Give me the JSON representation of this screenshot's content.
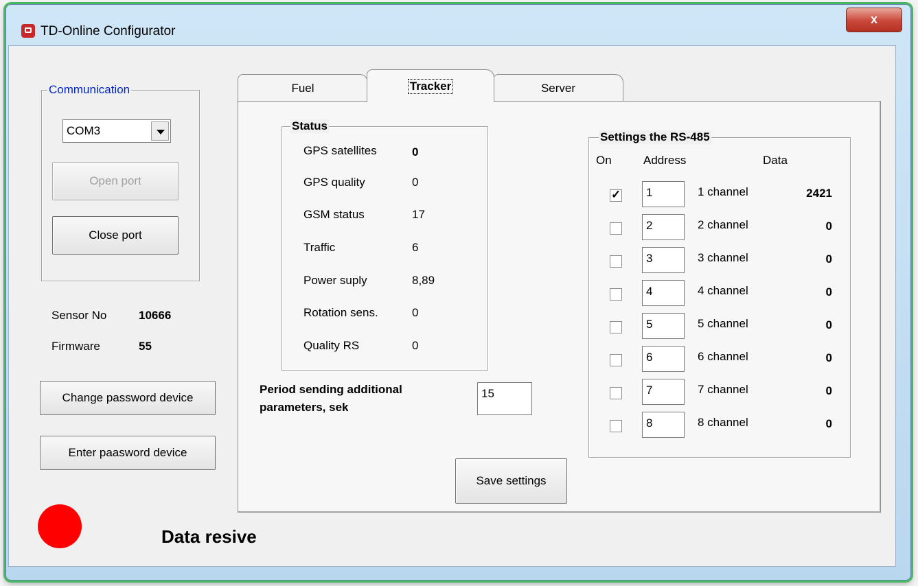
{
  "window": {
    "title": "TD-Online Configurator",
    "close_label": "x"
  },
  "communication": {
    "group_title": "Communication",
    "port": "COM3",
    "open_port_label": "Open port",
    "close_port_label": "Close port"
  },
  "device": {
    "sensor_label": "Sensor No",
    "sensor_value": "10666",
    "firmware_label": "Firmware",
    "firmware_value": "55",
    "change_password_label": "Change password device",
    "enter_password_label": "Enter paasword device"
  },
  "tabs": [
    {
      "label": "Fuel"
    },
    {
      "label": "Tracker"
    },
    {
      "label": "Server"
    }
  ],
  "status": {
    "title": "Status",
    "rows": [
      {
        "label": "GPS satellites",
        "value": "0"
      },
      {
        "label": "GPS quality",
        "value": "0"
      },
      {
        "label": "GSM status",
        "value": "17"
      },
      {
        "label": "Traffic",
        "value": "6"
      },
      {
        "label": "Power suply",
        "value": "8,89"
      },
      {
        "label": "Rotation sens.",
        "value": "0"
      },
      {
        "label": "Quality RS",
        "value": "0"
      }
    ]
  },
  "period": {
    "label_line1": "Period sending additional",
    "label_line2": "parameters, sek",
    "value": "15"
  },
  "rs485": {
    "title": "Settings the RS-485",
    "col_on": "On",
    "col_address": "Address",
    "col_data": "Data",
    "channels": [
      {
        "checked": true,
        "address": "1",
        "name": "1 channel",
        "data": "2421"
      },
      {
        "checked": false,
        "address": "2",
        "name": "2 channel",
        "data": "0"
      },
      {
        "checked": false,
        "address": "3",
        "name": "3 channel",
        "data": "0"
      },
      {
        "checked": false,
        "address": "4",
        "name": "4 channel",
        "data": "0"
      },
      {
        "checked": false,
        "address": "5",
        "name": "5 channel",
        "data": "0"
      },
      {
        "checked": false,
        "address": "6",
        "name": "6 channel",
        "data": "0"
      },
      {
        "checked": false,
        "address": "7",
        "name": "7 channel",
        "data": "0"
      },
      {
        "checked": false,
        "address": "8",
        "name": "8 channel",
        "data": "0"
      }
    ]
  },
  "save_label": "Save settings",
  "indicator": {
    "color": "#ff0000",
    "text": "Data resive"
  }
}
